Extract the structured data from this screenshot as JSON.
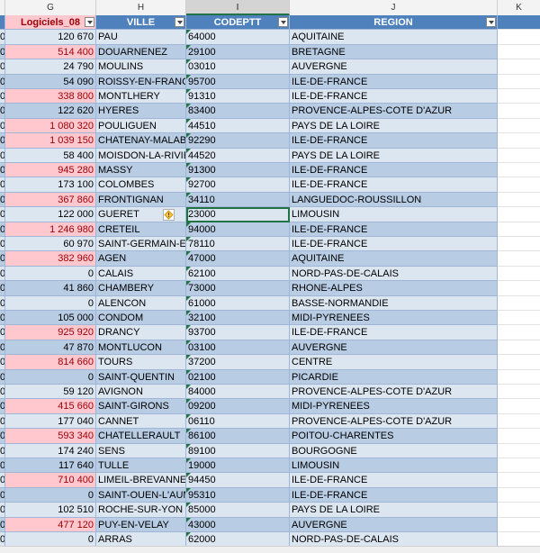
{
  "columns": {
    "f": "",
    "g": "G",
    "h": "H",
    "i": "I",
    "j": "J",
    "k": "K"
  },
  "headers": {
    "g": "Logiciels_08",
    "h": "VILLE",
    "i": "CODEPTT",
    "j": "REGION"
  },
  "col_f_value": "0",
  "colors": {
    "header_blue": "#4f81bd",
    "band_light": "#dce6f1",
    "band_dark": "#b8cce4",
    "negative_fill": "#ffc7ce",
    "negative_text": "#9c0006",
    "selection": "#217346"
  },
  "rows": [
    {
      "g": "120 670",
      "h": "PAU",
      "i": "64000",
      "j": "AQUITAINE",
      "neg": false
    },
    {
      "g": "514 400",
      "h": "DOUARNENEZ",
      "i": "29100",
      "j": "BRETAGNE",
      "neg": true
    },
    {
      "g": "24 790",
      "h": "MOULINS",
      "i": "03010",
      "j": "AUVERGNE",
      "neg": false
    },
    {
      "g": "54 090",
      "h": "ROISSY-EN-FRANCE",
      "i": "95700",
      "j": "ILE-DE-FRANCE",
      "neg": false
    },
    {
      "g": "338 800",
      "h": "MONTLHERY",
      "i": "91310",
      "j": "ILE-DE-FRANCE",
      "neg": true
    },
    {
      "g": "122 620",
      "h": "HYERES",
      "i": "83400",
      "j": "PROVENCE-ALPES-COTE D'AZUR",
      "neg": false
    },
    {
      "g": "1 080 320",
      "h": "POULIGUEN",
      "i": "44510",
      "j": "PAYS DE LA LOIRE",
      "neg": true
    },
    {
      "g": "1 039 150",
      "h": "CHATENAY-MALAB",
      "i": "92290",
      "j": "ILE-DE-FRANCE",
      "neg": true
    },
    {
      "g": "58 400",
      "h": "MOISDON-LA-RIVIE",
      "i": "44520",
      "j": "PAYS DE LA LOIRE",
      "neg": false
    },
    {
      "g": "945 280",
      "h": "MASSY",
      "i": "91300",
      "j": "ILE-DE-FRANCE",
      "neg": true
    },
    {
      "g": "173 100",
      "h": "COLOMBES",
      "i": "92700",
      "j": "ILE-DE-FRANCE",
      "neg": false
    },
    {
      "g": "367 860",
      "h": "FRONTIGNAN",
      "i": "34110",
      "j": "LANGUEDOC-ROUSSILLON",
      "neg": true
    },
    {
      "g": "122 000",
      "h": "GUERET",
      "i": "23000",
      "j": "LIMOUSIN",
      "neg": false
    },
    {
      "g": "1 246 980",
      "h": "CRETEIL",
      "i": "94000",
      "j": "ILE-DE-FRANCE",
      "neg": true
    },
    {
      "g": "60 970",
      "h": "SAINT-GERMAIN-EN",
      "i": "78110",
      "j": "ILE-DE-FRANCE",
      "neg": false
    },
    {
      "g": "382 960",
      "h": "AGEN",
      "i": "47000",
      "j": "AQUITAINE",
      "neg": true
    },
    {
      "g": "0",
      "h": "CALAIS",
      "i": "62100",
      "j": "NORD-PAS-DE-CALAIS",
      "neg": false
    },
    {
      "g": "41 860",
      "h": "CHAMBERY",
      "i": "73000",
      "j": "RHONE-ALPES",
      "neg": false
    },
    {
      "g": "0",
      "h": "ALENCON",
      "i": "61000",
      "j": "BASSE-NORMANDIE",
      "neg": false
    },
    {
      "g": "105 000",
      "h": "CONDOM",
      "i": "32100",
      "j": "MIDI-PYRENEES",
      "neg": false
    },
    {
      "g": "925 920",
      "h": "DRANCY",
      "i": "93700",
      "j": "ILE-DE-FRANCE",
      "neg": true
    },
    {
      "g": "47 870",
      "h": "MONTLUCON",
      "i": "03100",
      "j": "AUVERGNE",
      "neg": false
    },
    {
      "g": "814 660",
      "h": "TOURS",
      "i": "37200",
      "j": "CENTRE",
      "neg": true
    },
    {
      "g": "0",
      "h": "SAINT-QUENTIN",
      "i": "02100",
      "j": "PICARDIE",
      "neg": false
    },
    {
      "g": "59 120",
      "h": "AVIGNON",
      "i": "84000",
      "j": "PROVENCE-ALPES-COTE D'AZUR",
      "neg": false
    },
    {
      "g": "415 660",
      "h": "SAINT-GIRONS",
      "i": "09200",
      "j": "MIDI-PYRENEES",
      "neg": true
    },
    {
      "g": "177 040",
      "h": "CANNET",
      "i": "06110",
      "j": "PROVENCE-ALPES-COTE D'AZUR",
      "neg": false
    },
    {
      "g": "593 340",
      "h": "CHATELLERAULT",
      "i": "86100",
      "j": "POITOU-CHARENTES",
      "neg": true
    },
    {
      "g": "174 240",
      "h": "SENS",
      "i": "89100",
      "j": "BOURGOGNE",
      "neg": false
    },
    {
      "g": "117 640",
      "h": "TULLE",
      "i": "19000",
      "j": "LIMOUSIN",
      "neg": false
    },
    {
      "g": "710 400",
      "h": "LIMEIL-BREVANNES",
      "i": "94450",
      "j": "ILE-DE-FRANCE",
      "neg": true
    },
    {
      "g": "0",
      "h": "SAINT-OUEN-L'AUM",
      "i": "95310",
      "j": "ILE-DE-FRANCE",
      "neg": false
    },
    {
      "g": "102 510",
      "h": "ROCHE-SUR-YON",
      "i": "85000",
      "j": "PAYS DE LA LOIRE",
      "neg": false
    },
    {
      "g": "477 120",
      "h": "PUY-EN-VELAY",
      "i": "43000",
      "j": "AUVERGNE",
      "neg": true
    },
    {
      "g": "0",
      "h": "ARRAS",
      "i": "62000",
      "j": "NORD-PAS-DE-CALAIS",
      "neg": false
    }
  ],
  "active_row_index": 12,
  "warning_icon": "error-warning-diamond-icon"
}
